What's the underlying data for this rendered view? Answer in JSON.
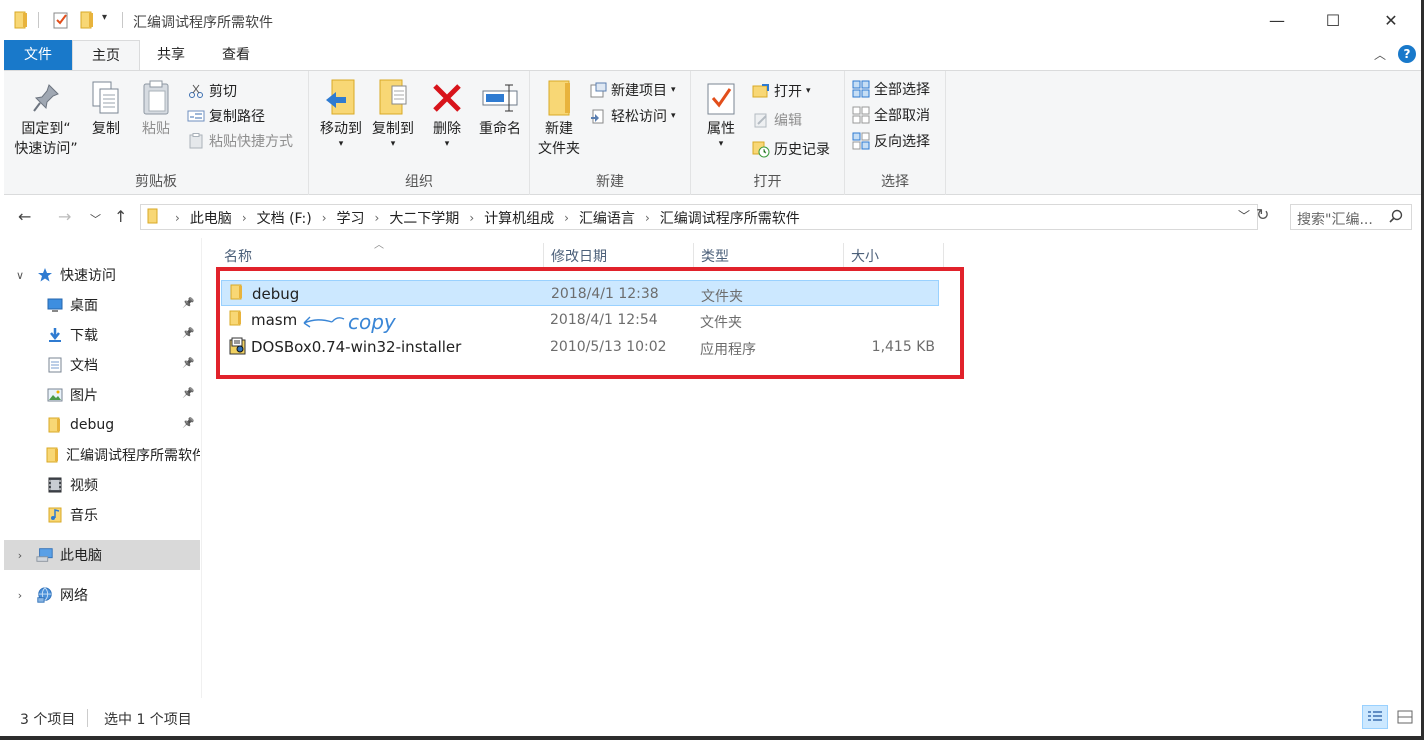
{
  "window": {
    "title": "汇编调试程序所需软件",
    "min_symbol": "—",
    "max_symbol": "☐",
    "close_symbol": "✕"
  },
  "tabs": [
    "文件",
    "主页",
    "共享",
    "查看"
  ],
  "ribbon": {
    "clipboard": {
      "label": "剪贴板",
      "pin_label_1": "固定到“",
      "pin_label_2": "快速访问”",
      "copy": "复制",
      "paste": "粘贴",
      "cut": "剪切",
      "copy_path": "复制路径",
      "paste_shortcut": "粘贴快捷方式"
    },
    "organize": {
      "label": "组织",
      "move_to": "移动到",
      "copy_to": "复制到",
      "delete": "删除",
      "rename": "重命名"
    },
    "new": {
      "label": "新建",
      "new_folder_1": "新建",
      "new_folder_2": "文件夹",
      "new_item": "新建项目",
      "easy_access": "轻松访问"
    },
    "open": {
      "label": "打开",
      "properties": "属性",
      "open": "打开",
      "edit": "编辑",
      "history": "历史记录"
    },
    "select": {
      "label": "选择",
      "select_all": "全部选择",
      "select_none": "全部取消",
      "invert": "反向选择"
    }
  },
  "address": {
    "crumbs": [
      "此电脑",
      "文档 (F:)",
      "学习",
      "大二下学期",
      "计算机组成",
      "汇编语言",
      "汇编调试程序所需软件"
    ],
    "search_placeholder": "搜索\"汇编..."
  },
  "sidebar": {
    "quick_access": "快速访问",
    "items": [
      {
        "label": "桌面",
        "icon": "desktop-icon",
        "pinned": true
      },
      {
        "label": "下载",
        "icon": "download-icon",
        "pinned": true
      },
      {
        "label": "文档",
        "icon": "document-icon",
        "pinned": true
      },
      {
        "label": "图片",
        "icon": "picture-icon",
        "pinned": true
      },
      {
        "label": "debug",
        "icon": "folder-icon",
        "pinned": true
      },
      {
        "label": "汇编调试程序所需软件",
        "icon": "folder-icon",
        "pinned": false
      },
      {
        "label": "视频",
        "icon": "video-icon",
        "pinned": false
      },
      {
        "label": "音乐",
        "icon": "music-icon",
        "pinned": false
      }
    ],
    "this_pc": "此电脑",
    "network": "网络"
  },
  "columns": [
    "名称",
    "修改日期",
    "类型",
    "大小"
  ],
  "files": [
    {
      "name": "debug",
      "date": "2018/4/1 12:38",
      "type": "文件夹",
      "size": "",
      "icon": "folder-icon",
      "selected": true
    },
    {
      "name": "masm",
      "date": "2018/4/1 12:54",
      "type": "文件夹",
      "size": "",
      "icon": "folder-icon",
      "selected": false
    },
    {
      "name": "DOSBox0.74-win32-installer",
      "date": "2010/5/13 10:02",
      "type": "应用程序",
      "size": "1,415 KB",
      "icon": "installer-icon",
      "selected": false
    }
  ],
  "annotation": {
    "handwritten": "copy",
    "highlight_color": "#e1222b",
    "ink_color": "#3a86d6"
  },
  "status": {
    "item_count": "3 个项目",
    "selection": "选中 1 个项目"
  },
  "colors": {
    "accent": "#1979ca",
    "selection_bg": "#cce8ff",
    "selection_border": "#99d1ff"
  }
}
